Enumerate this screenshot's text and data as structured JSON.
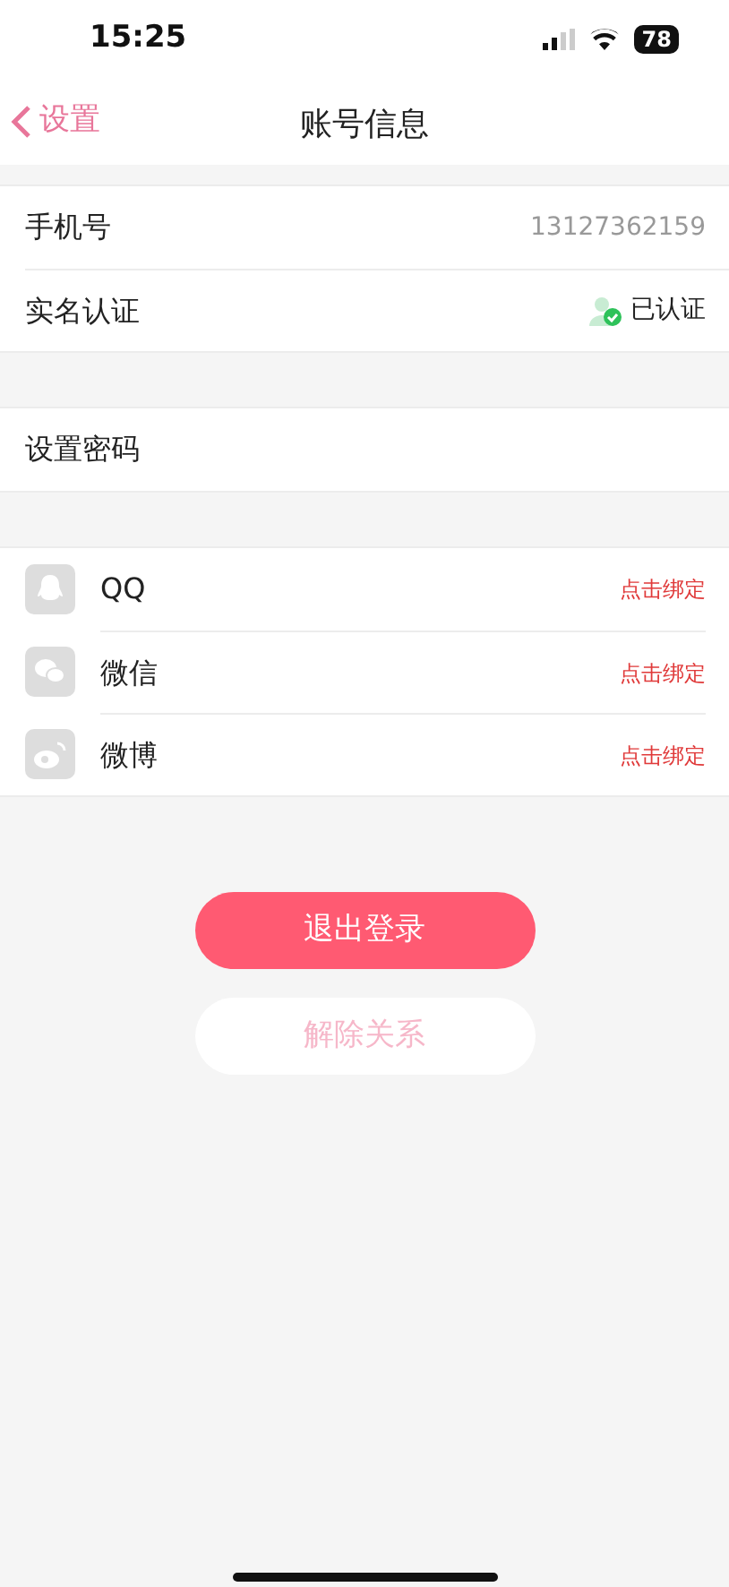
{
  "status_bar": {
    "time": "15:25",
    "battery": "78"
  },
  "nav": {
    "back": "设置",
    "title": "账号信息"
  },
  "account_rows": [
    {
      "label": "手机号",
      "value": "13127362159",
      "verified": false
    },
    {
      "label": "实名认证",
      "value": "已认证",
      "verified": true
    }
  ],
  "password_row": {
    "label": "设置密码"
  },
  "bindings": [
    {
      "kind": "qq",
      "name": "QQ",
      "action": "点击绑定"
    },
    {
      "kind": "wechat",
      "name": "微信",
      "action": "点击绑定"
    },
    {
      "kind": "weibo",
      "name": "微博",
      "action": "点击绑定"
    }
  ],
  "buttons": [
    {
      "kind": "primary",
      "label": "退出登录"
    },
    {
      "kind": "secondary",
      "label": "解除关系"
    }
  ]
}
